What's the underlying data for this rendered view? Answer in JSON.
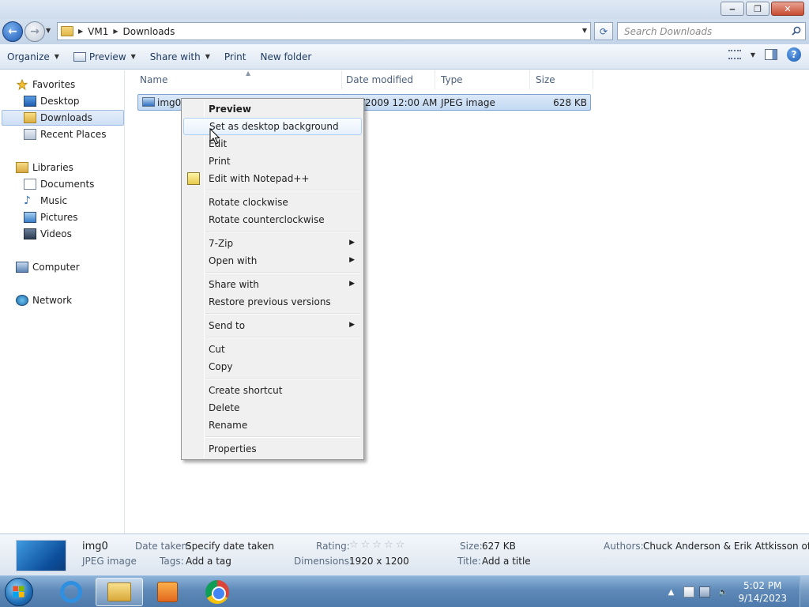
{
  "window": {
    "minimize_glyph": "‒",
    "maximize_glyph": "❐",
    "close_glyph": "✕"
  },
  "address": {
    "breadcrumbs": [
      "VM1",
      "Downloads"
    ],
    "search_placeholder": "Search Downloads"
  },
  "toolbar": {
    "organize": "Organize",
    "preview": "Preview",
    "share_with": "Share with",
    "print": "Print",
    "new_folder": "New folder"
  },
  "sidebar": {
    "favorites": "Favorites",
    "desktop": "Desktop",
    "downloads": "Downloads",
    "recent_places": "Recent Places",
    "libraries": "Libraries",
    "documents": "Documents",
    "music": "Music",
    "pictures": "Pictures",
    "videos": "Videos",
    "computer": "Computer",
    "network": "Network"
  },
  "columns": {
    "name": "Name",
    "date_modified": "Date modified",
    "type": "Type",
    "size": "Size"
  },
  "file": {
    "name": "img0",
    "date_partial": "/2009 12:00 AM",
    "type": "JPEG image",
    "size": "628 KB"
  },
  "context_menu": {
    "preview": "Preview",
    "set_desktop_background": "Set as desktop background",
    "edit": "Edit",
    "print": "Print",
    "edit_notepad": "Edit with Notepad++",
    "rotate_cw": "Rotate clockwise",
    "rotate_ccw": "Rotate counterclockwise",
    "seven_zip": "7-Zip",
    "open_with": "Open with",
    "share_with": "Share with",
    "restore_previous": "Restore previous versions",
    "send_to": "Send to",
    "cut": "Cut",
    "copy": "Copy",
    "create_shortcut": "Create shortcut",
    "delete": "Delete",
    "rename": "Rename",
    "properties": "Properties"
  },
  "details": {
    "name": "img0",
    "type": "JPEG image",
    "date_taken_label": "Date taken:",
    "date_taken_value": "Specify date taken",
    "tags_label": "Tags:",
    "tags_value": "Add a tag",
    "rating_label": "Rating:",
    "rating_stars": "☆☆☆☆☆",
    "dimensions_label": "Dimensions:",
    "dimensions_value": "1920 x 1200",
    "size_label": "Size:",
    "size_value": "627 KB",
    "title_label": "Title:",
    "title_value": "Add a title",
    "authors_label": "Authors:",
    "authors_value": "Chuck Anderson & Erik Attkisson of..."
  },
  "taskbar": {
    "time": "5:02 PM",
    "date": "9/14/2023",
    "tray_expand": "▲"
  }
}
